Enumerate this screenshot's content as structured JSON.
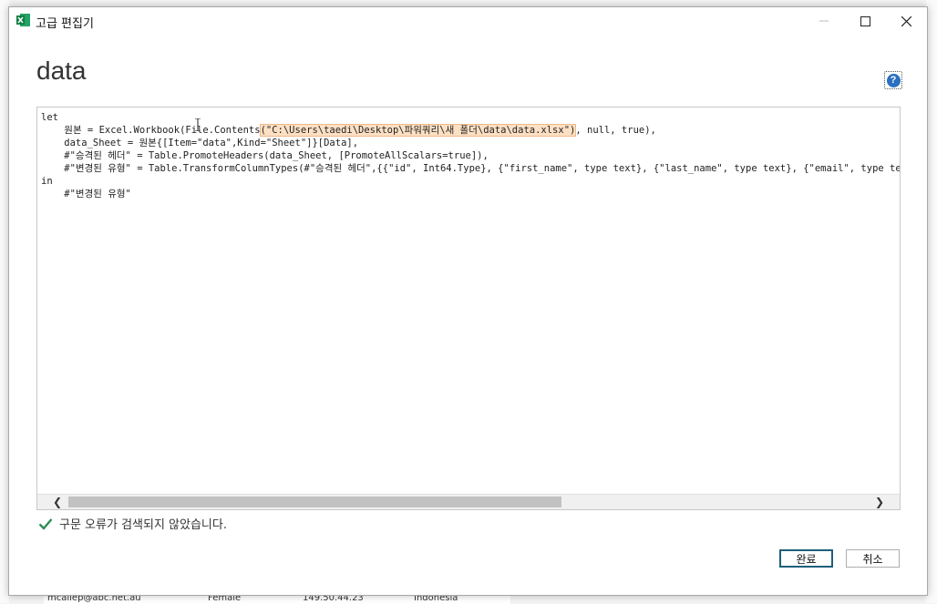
{
  "window": {
    "title": "고급 편집기",
    "app_icon": "excel-icon",
    "controls": {
      "minimize": "minimize-icon",
      "maximize": "maximize-icon",
      "close": "close-icon"
    }
  },
  "query_name": "data",
  "help": {
    "label": "?"
  },
  "editor": {
    "lines": {
      "l1": "let",
      "l2_pre": "    원본 = Excel.Workbook(File.Contents",
      "l2_hl": "(\"C:\\Users\\taedi\\Desktop\\파워쿼리\\새 폴더\\data\\data.xlsx\")",
      "l2_post": ", null, true),",
      "l3": "    data_Sheet = 원본{[Item=\"data\",Kind=\"Sheet\"]}[Data],",
      "l4": "    #\"승격된 헤더\" = Table.PromoteHeaders(data_Sheet, [PromoteAllScalars=true]),",
      "l5": "    #\"변경된 유형\" = Table.TransformColumnTypes(#\"승격된 헤더\",{{\"id\", Int64.Type}, {\"first_name\", type text}, {\"last_name\", type text}, {\"email\", type text}",
      "l6": "in",
      "l7": "    #\"변경된 유형\""
    },
    "scroll": {
      "left_arrow": "❮",
      "right_arrow": "❯"
    }
  },
  "status": {
    "text": "구문 오류가 검색되지 않았습니다."
  },
  "buttons": {
    "ok": "완료",
    "cancel": "취소"
  },
  "background": {
    "bottom_row": {
      "email": "mcallep@abc.net.au",
      "gender": "Female",
      "ip": "149.50.44.23",
      "country": "Indonesia"
    }
  },
  "colors": {
    "highlight": "#fde0c4",
    "check": "#2e8b57",
    "help": "#2a6fc0",
    "ok_border": "#1e5f7a"
  }
}
